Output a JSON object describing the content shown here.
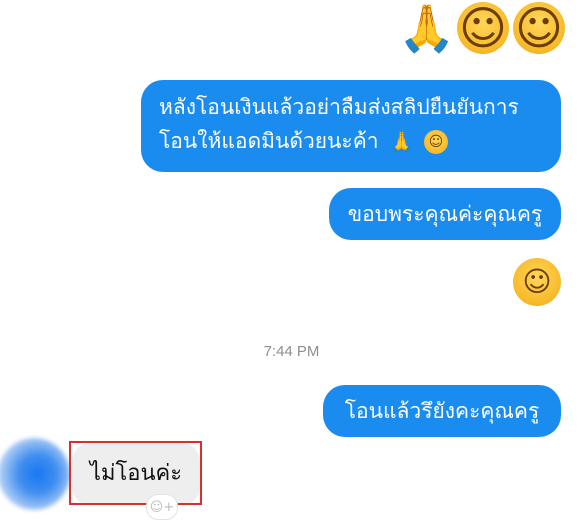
{
  "messages": {
    "emoji_row": {
      "hands": "🙏",
      "smile1": "☺",
      "smile2": "☺"
    },
    "outgoing_1": {
      "line1": "หลังโอนเงินแล้วอย่าลืมส่งสลิปยืนยันการ",
      "line2": "โอนให้แอดมินด้วยนะค้า",
      "hands": "🙏",
      "smile": "☺"
    },
    "outgoing_2": {
      "text": "ขอบพระคุณค่ะคุณครู"
    },
    "outgoing_emoji": {
      "smile": "☺"
    },
    "timestamp": "7:44 PM",
    "outgoing_3": {
      "text": "โอนแล้วรึยังคะคุณครู"
    },
    "incoming_1": {
      "text": "ไม่โอนค่ะ",
      "reaction_icon": "smiley-add-icon"
    }
  },
  "colors": {
    "outgoing_bubble": "#1a8cf0",
    "incoming_bubble": "#eeeeee",
    "highlight_box": "#d9302a",
    "timestamp_text": "#8e8e93"
  }
}
